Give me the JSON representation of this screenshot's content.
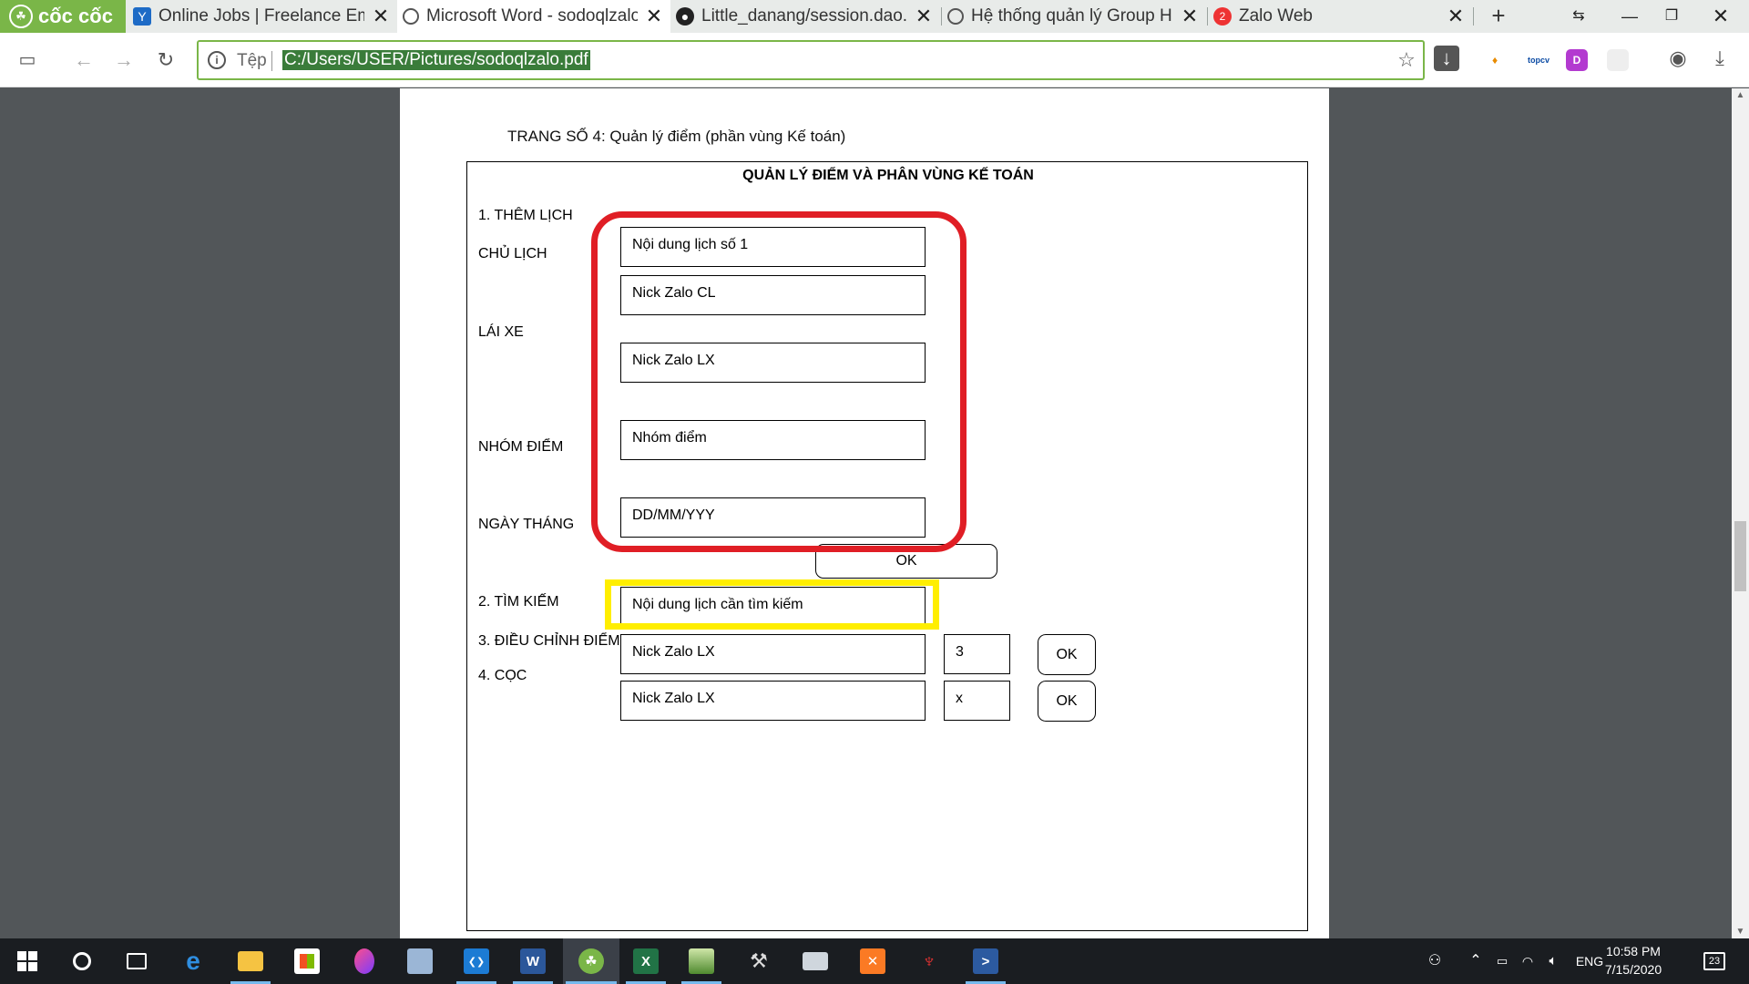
{
  "browser": {
    "brand": "cốc cốc",
    "tabs": [
      {
        "title": "Online Jobs | Freelance Emplo",
        "favicon": "upwork-icon"
      },
      {
        "title": "Microsoft Word - sodoqlzalo",
        "favicon": "globe-icon"
      },
      {
        "title": "Little_danang/session.dao.ph",
        "favicon": "github-icon"
      },
      {
        "title": "Hệ thống quản lý Group High",
        "favicon": "globe-icon"
      },
      {
        "title": "Zalo Web",
        "favicon": "zalo-icon",
        "badge": "2"
      }
    ],
    "address_bar": {
      "scheme_label": "Tệp",
      "url": "C:/Users/USER/Pictures/sodoqlzalo.pdf"
    },
    "extensions": [
      "coccoc-icon",
      "topcv-icon",
      "d-icon",
      "blank-icon"
    ],
    "ext_labels": {
      "topcv": "topcv",
      "d": "D"
    }
  },
  "document": {
    "page_heading": "TRANG SỐ 4: Quản lý điểm (phần vùng Kế toán)",
    "frame_title": "QUẢN LÝ ĐIỂM VÀ PHÂN VÙNG KẾ TOÁN",
    "labels": {
      "them_lich": "1. THÊM LỊCH",
      "chu_lich": "CHỦ LỊCH",
      "lai_xe": "LÁI XE",
      "nhom_diem": "NHÓM ĐIỂM",
      "ngay_thang": "NGÀY THÁNG",
      "tim_kiem": "2. TÌM KIẾM",
      "dieu_chinh": "3. ĐIỀU CHỈNH ĐIỂM",
      "coc": "4. CỌC"
    },
    "fields": {
      "noi_dung": "Nội dung lịch số 1",
      "nick_cl": "Nick Zalo CL",
      "nick_lx": "Nick Zalo LX",
      "nhom_diem": "Nhóm điểm",
      "ngay": "DD/MM/YYY",
      "tim_kiem": "Nội dung lịch cần tìm kiếm",
      "dieu_chinh_nick": "Nick Zalo LX",
      "dieu_chinh_value": "3",
      "coc_nick": "Nick Zalo LX",
      "coc_value": "x"
    },
    "buttons": {
      "ok": "OK"
    },
    "highlight_colors": {
      "red": "#e01e25",
      "yellow": "#ffee00"
    }
  },
  "taskbar": {
    "apps": [
      "start-icon",
      "search-circle-icon",
      "task-view-icon",
      "edge-icon",
      "file-explorer-icon",
      "store-icon",
      "paint-drop-icon",
      "box-icon",
      "vscode-icon",
      "word-icon",
      "coccoc-icon",
      "excel-icon",
      "photo-icon",
      "tools-icon",
      "scanner-icon",
      "xampp-icon",
      "game-icon",
      "powershell-icon"
    ],
    "app_glyphs": {
      "word": "W",
      "excel": "X",
      "xampp": "✕",
      "powershell": ">",
      "vscode": "❮❯"
    },
    "tray": {
      "language": "ENG",
      "time": "10:58 PM",
      "date": "7/15/2020",
      "notifications": "23"
    }
  }
}
